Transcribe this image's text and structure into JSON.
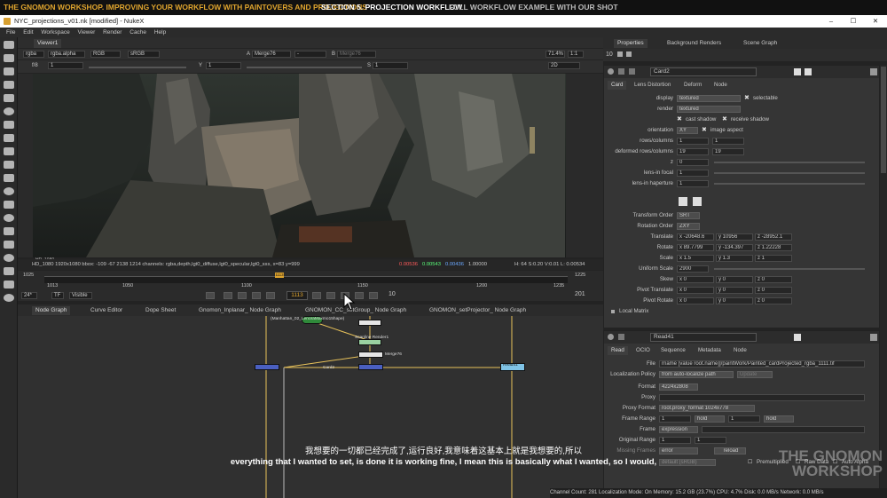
{
  "banner": {
    "course_title": "THE GNOMON WORKSHOP. IMPROVING YOUR WORKFLOW WITH PAINTOVERS AND PROJECTIONS",
    "section": "SECTION 5.  PROJECTION WORKFLOW",
    "section_desc": "FULL WORKFLOW EXAMPLE WITH OUR SHOT"
  },
  "window": {
    "title": "NYC_projections_v01.nk [modified] - NukeX",
    "controls": [
      "–",
      "☐",
      "✕"
    ]
  },
  "menu": [
    "File",
    "Edit",
    "Workspace",
    "Viewer",
    "Render",
    "Cache",
    "Help"
  ],
  "viewer": {
    "tab": "Viewer1",
    "channels": "rgba",
    "alpha": "rgba.alpha",
    "colorspace_mode": "RGB",
    "lut": "sRGB",
    "input_a": "A",
    "input_a_node": "Merge76",
    "dash": "-",
    "input_b": "B",
    "input_b_node": "Merge76",
    "zoom": "71.4%",
    "ratio": "1:1",
    "mode": "2D",
    "fstop": "f/8",
    "fstop_value": "1",
    "y_label": "Y",
    "y_value": "1",
    "s_label": "S",
    "s_value": "1",
    "format_corner": "HD_1080",
    "status_text": "HD_1080 1920x1080  bbox: -109 -67 2138 1214 channels: rgba,depth,lgt0_diffuse,lgt0_specular,lgt0_sss,  x=83 y=999",
    "pixel_r": "0.00536",
    "pixel_g": "0.00543",
    "pixel_b": "0.00436",
    "pixel_a": "1.00000",
    "hsvl": "H: 64 S:0.20 V:0.01  L: 0.00534"
  },
  "timeline": {
    "start": "1025",
    "end": "1225",
    "left_value": "1013",
    "right_value": "1235",
    "ticks": [
      "1050",
      "1100",
      "1150",
      "1200"
    ],
    "marker": "1113"
  },
  "playback": {
    "fps": "24*",
    "tf": "TF",
    "visible": "Visible",
    "current_frame": "1113",
    "step": "10",
    "end_frame": "201"
  },
  "node_tabs": [
    "Node Graph",
    "Curve Editor",
    "Dope Sheet",
    "Gnomon_Inplanar_ Node Graph",
    "GNOMON_CC_setGroup_ Node Graph",
    "GNOMON_setProjector_ Node Graph"
  ],
  "node_graph": {
    "labels": [
      "(Manhattan_02_LenoraMaxmo15hape)",
      "Scanline Render1",
      "Merge76",
      "Read41",
      "Card2"
    ]
  },
  "properties": {
    "tabs": [
      "Properties",
      "Background Renders",
      "Scene Graph"
    ],
    "count": "10",
    "card": {
      "name": "Card2",
      "subtabs": [
        "Card",
        "Lens Distortion",
        "Deform",
        "Node"
      ],
      "display_label": "display",
      "display_value": "textured",
      "selectable": "selectable",
      "render_label": "render",
      "render_value": "textured",
      "cast_shadow": "cast shadow",
      "receive_shadow": "receive shadow",
      "orientation_label": "orientation",
      "orientation_value": "XY",
      "image_aspect": "image aspect",
      "rows_columns_label": "rows/columns",
      "rows": "1",
      "columns": "1",
      "deformed_label": "deformed rows/columns",
      "def_rows": "19",
      "def_cols": "19",
      "z_label": "z",
      "z_value": "0",
      "lens_focal_label": "lens-in focal",
      "lens_focal_value": "1",
      "lens_haperture_label": "lens-in haperture",
      "lens_haperture_value": "1",
      "transform_order_label": "Transform Order",
      "transform_order_value": "SRT",
      "rotation_order_label": "Rotation Order",
      "rotation_order_value": "ZXY",
      "translate_label": "Translate",
      "translate_x": "x -20648.6",
      "translate_y": "y 10956",
      "translate_z": "z -28952.1",
      "rotate_label": "Rotate",
      "rotate_x": "x 89.7799",
      "rotate_y": "y -134.397",
      "rotate_z": "z 1.22228",
      "scale_label": "Scale",
      "scale_x": "x 1.5",
      "scale_y": "y 1.3",
      "scale_z": "z 1",
      "uniform_scale_label": "Uniform Scale",
      "uniform_scale_value": "2900",
      "skew_label": "Skew",
      "skew_x": "x 0",
      "skew_y": "y 0",
      "skew_z": "z 0",
      "pivot_translate_label": "Pivot Translate",
      "pt_x": "x 0",
      "pt_y": "y 0",
      "pt_z": "z 0",
      "pivot_rotate_label": "Pivot Rotate",
      "pr_x": "x 0",
      "pr_y": "y 0",
      "pr_z": "z 0",
      "local_matrix": "Local Matrix"
    },
    "read": {
      "name": "Read41",
      "subtabs": [
        "Read",
        "OCIO",
        "Sequence",
        "Metadata",
        "Node"
      ],
      "file_label": "File",
      "file_value": "rname [value root.name]]/paintWork/Painted_cardProjected_rgba_1111.tif",
      "localization_label": "Localization Policy",
      "localization_value": "from auto-localize path",
      "update_button": "Update",
      "format_label": "Format",
      "format_value": "4224x2808",
      "proxy_label": "Proxy",
      "proxy_format_label": "Proxy Format",
      "proxy_format_value": "root.proxy_format 1024x778",
      "frame_range_label": "Frame Range",
      "frame_start": "1",
      "frame_start_mode": "hold",
      "frame_end": "1",
      "frame_end_mode": "hold",
      "frame_label": "Frame",
      "frame_value": "expression",
      "original_range_label": "Original Range",
      "orig_start": "1",
      "orig_end": "1",
      "missing_frames_label": "Missing Frames",
      "missing_frames_value": "error",
      "reload_button": "reload",
      "colorspace_value": "default (sRGB)",
      "premultiplied": "Premultiplied",
      "raw_data": "Raw Data",
      "auto_alpha": "Auto Alpha"
    }
  },
  "subtitles": {
    "chinese": "我想要的一切都已经完成了,运行良好,我意味着这基本上就是我想要的,所以",
    "english": "everything that I wanted to set, is done it is working fine, I mean this is basically what I wanted, so I would,"
  },
  "statusbar": "Channel Count: 281  Localization Mode: On  Memory: 15.2 GB (23.7%)  CPU: 4.7%  Disk: 0.0 MB/s  Network: 0.0 MB/s",
  "watermark": {
    "line1": "THE GNOMON",
    "line2": "WORKSHOP"
  },
  "colors": {
    "banner_accent": "#e0a52e",
    "red_value": "#ff5a5a",
    "green_value": "#5aff7a",
    "blue_value": "#6aa8ff",
    "node_blue": "#4a5fc0",
    "node_green": "#2f8a3a",
    "node_cyan": "#7fc3e6",
    "pipe_yellow": "#e8c25a"
  }
}
